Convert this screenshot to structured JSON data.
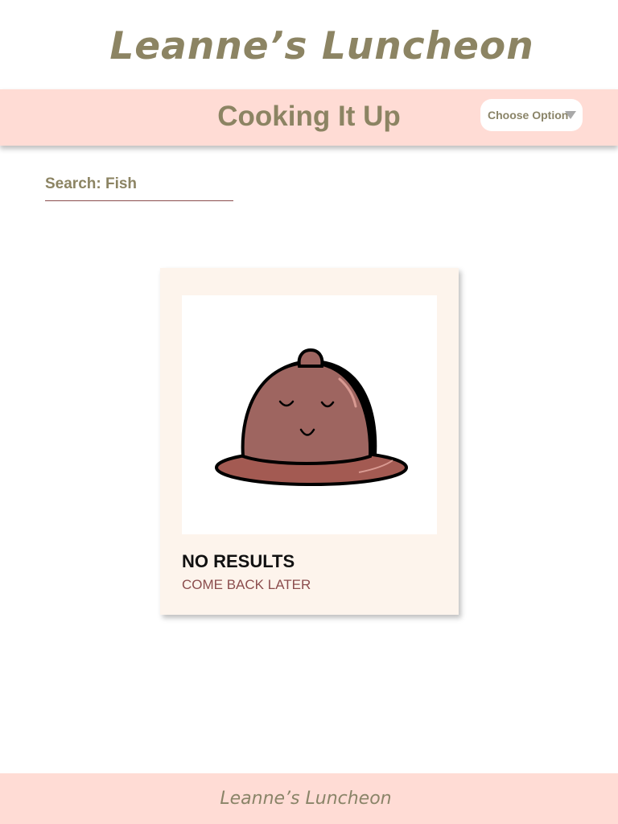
{
  "site": {
    "title": "Leanne’s Luncheon"
  },
  "header": {
    "section_title": "Cooking It Up",
    "dropdown_label": "Choose Option"
  },
  "search": {
    "label": "Search: Fish"
  },
  "result_card": {
    "title": "NO RESULTS",
    "subtitle": "COME BACK LATER",
    "image_icon": "cloche-icon"
  },
  "footer": {
    "text": "Leanne’s Luncheon"
  },
  "colors": {
    "brand_text": "#8c8463",
    "header_bg": "#ffdcd5",
    "card_bg": "#fdf4ec",
    "accent": "#8b4d4d"
  }
}
